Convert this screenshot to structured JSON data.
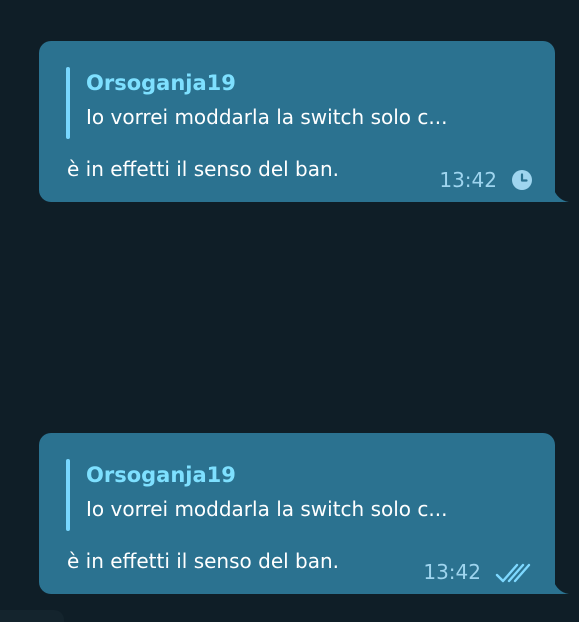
{
  "messages": [
    {
      "reply_author": "Orsoganja19",
      "reply_text": "Io vorrei moddarla la switch solo c...",
      "text": "è in effetti il senso del ban.",
      "time": "13:42",
      "status_icon": "clock-icon"
    },
    {
      "reply_author": "Orsoganja19",
      "reply_text": "Io vorrei moddarla la switch solo c...",
      "text": "è in effetti il senso del ban.",
      "time": "13:42",
      "status_icon": "double-check-icon"
    }
  ],
  "colors": {
    "background": "#0f1e27",
    "bubble": "#2b7290",
    "reply_accent": "#78d7ff",
    "reply_author": "#7ee0ff",
    "timestamp": "#9fd5ef",
    "text": "#ffffff"
  }
}
